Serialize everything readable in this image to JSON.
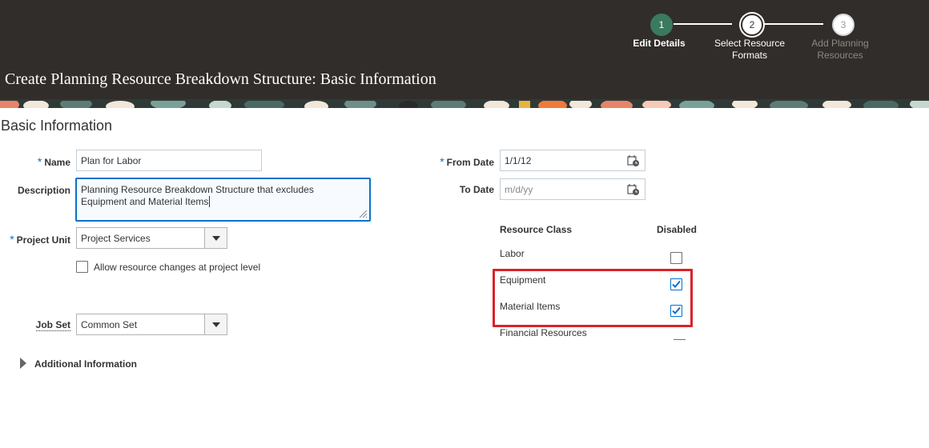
{
  "header": {
    "title": "Create Planning Resource Breakdown Structure: Basic Information",
    "steps": [
      {
        "number": "1",
        "label": "Edit Details",
        "state": "completed"
      },
      {
        "number": "2",
        "label_line1": "Select Resource",
        "label_line2": "Formats",
        "state": "current"
      },
      {
        "number": "3",
        "label_line1": "Add Planning",
        "label_line2": "Resources",
        "state": "upcoming"
      }
    ]
  },
  "section": {
    "title": "Basic Information"
  },
  "form": {
    "required_marker": "*",
    "name": {
      "label": "Name",
      "value": "Plan for Labor"
    },
    "description": {
      "label": "Description",
      "line1": "Planning Resource Breakdown Structure that excludes",
      "line2": "Equipment and Material Items"
    },
    "project_unit": {
      "label": "Project Unit",
      "value": "Project Services"
    },
    "allow_changes": {
      "label": "Allow resource changes at project level",
      "checked": false
    },
    "job_set": {
      "label": "Job Set",
      "value": "Common Set"
    },
    "additional_info": {
      "label": "Additional Information"
    },
    "from_date": {
      "label": "From Date",
      "value": "1/1/12"
    },
    "to_date": {
      "label": "To Date",
      "placeholder": "m/d/yy"
    }
  },
  "resource_table": {
    "col_class": "Resource Class",
    "col_disabled": "Disabled",
    "rows": [
      {
        "name": "Labor",
        "disabled": false
      },
      {
        "name": "Equipment",
        "disabled": true
      },
      {
        "name": "Material Items",
        "disabled": true
      },
      {
        "name": "Financial Resources",
        "disabled": false
      }
    ]
  },
  "colors": {
    "header_bg": "#312d2a",
    "step_complete": "#3b7a5e",
    "accent": "#0572ce",
    "highlight": "#d9232a"
  }
}
